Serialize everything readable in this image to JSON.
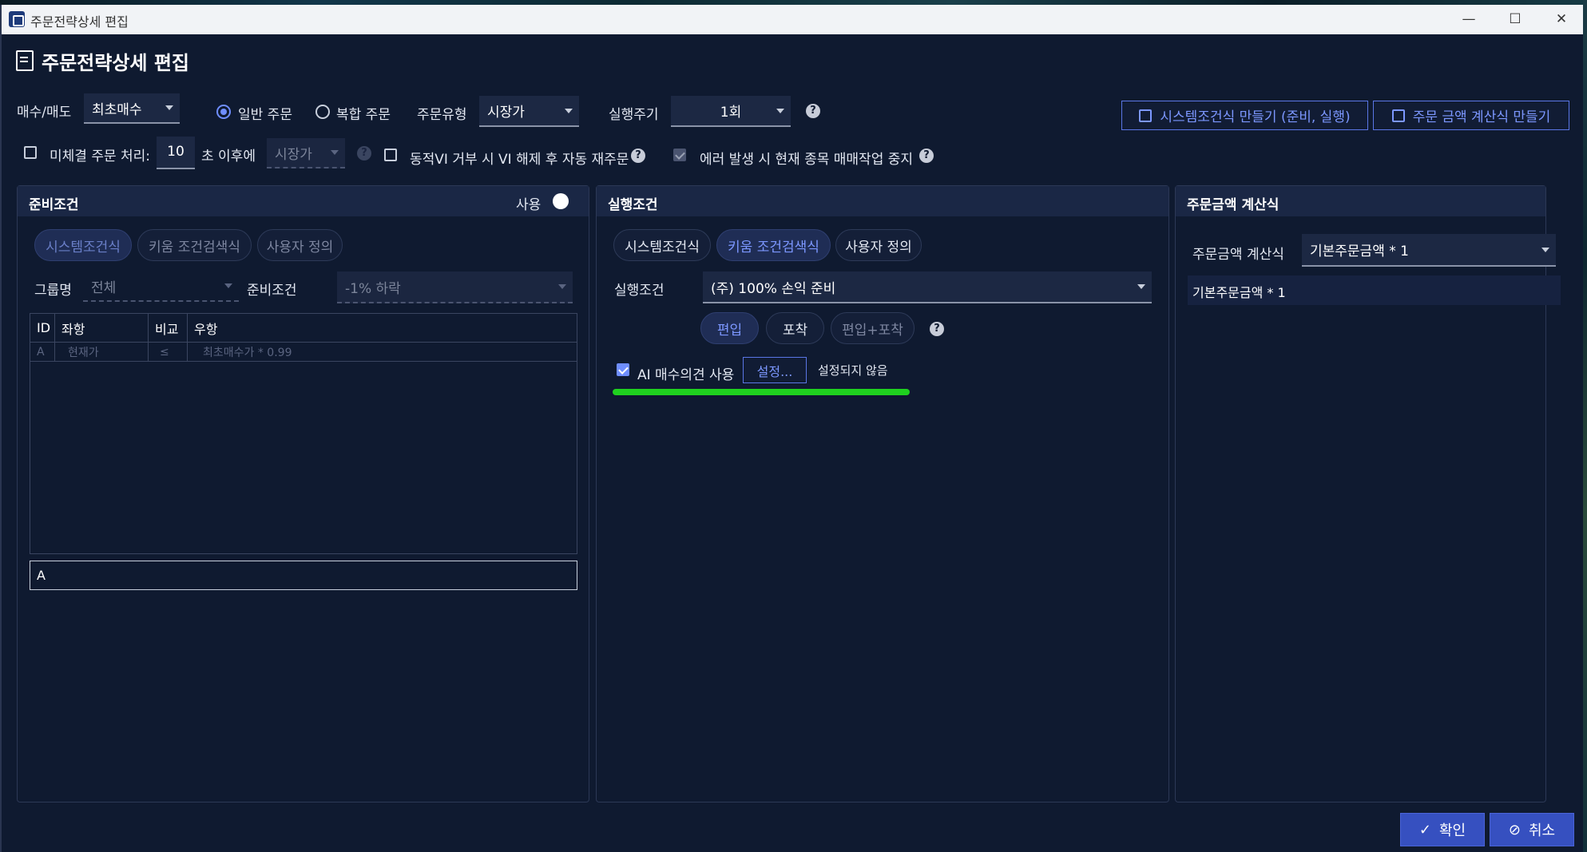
{
  "window": {
    "title": "주문전략상세 편집"
  },
  "heading": "주문전략상세 편집",
  "top": {
    "buysell_label": "매수/매도",
    "buysell_value": "최초매수",
    "radio_normal": "일반 주문",
    "radio_complex": "복합 주문",
    "ordertype_label": "주문유형",
    "ordertype_value": "시장가",
    "cycle_label": "실행주기",
    "cycle_value": "1회",
    "btn_system": "시스템조건식 만들기 (준비, 실행)",
    "btn_amount": "주문 금액 계산식 만들기"
  },
  "row2": {
    "unfilled_label": "미체결 주문 처리:",
    "seconds_value": "10",
    "after_label": "초 이후에",
    "after_select": "시장가",
    "vi_label": "동적VI 거부 시 VI 해제 후 자동 재주문",
    "error_label": "에러 발생 시 현재 종목 매매작업 중지"
  },
  "prep": {
    "title": "준비조건",
    "use_label": "사용",
    "tabs": [
      "시스템조건식",
      "키움 조건검색식",
      "사용자 정의"
    ],
    "group_label": "그룹명",
    "group_value": "전체",
    "cond_label": "준비조건",
    "cond_value": "-1% 하락",
    "grid_headers": [
      "ID",
      "좌항",
      "비교",
      "우항"
    ],
    "grid_row": [
      "A",
      "현재가",
      "≤",
      "최초매수가 * 0.99"
    ],
    "expression": "A"
  },
  "exec": {
    "title": "실행조건",
    "tabs": [
      "시스템조건식",
      "키움 조건검색식",
      "사용자 정의"
    ],
    "cond_label": "실행조건",
    "cond_value": "(주) 100% 손익 준비",
    "modes": [
      "편입",
      "포착",
      "편입+포착"
    ],
    "ai_label": "AI 매수의견 사용",
    "settings_btn": "설정...",
    "not_set": "설정되지 않음"
  },
  "amount": {
    "title": "주문금액 계산식",
    "label": "주문금액 계산식",
    "value": "기본주문금액 * 1",
    "display": "기본주문금액 * 1"
  },
  "footer": {
    "ok": "확인",
    "cancel": "취소"
  },
  "colors": {
    "accent": "#6f8eff",
    "highlight_underline": "#1fd11f",
    "button": "#3650c0"
  }
}
